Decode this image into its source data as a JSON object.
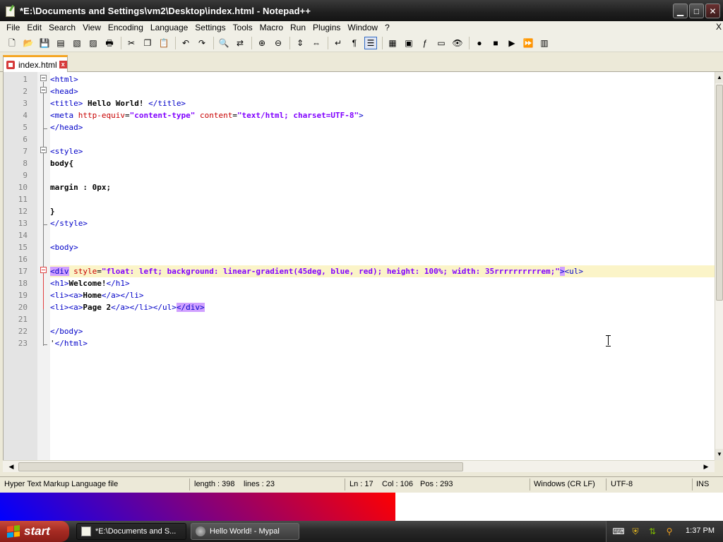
{
  "window": {
    "title": "*E:\\Documents and Settings\\vm2\\Desktop\\index.html - Notepad++",
    "minimize": "▁",
    "maximize": "□",
    "close": "✕"
  },
  "menu": [
    "File",
    "Edit",
    "Search",
    "View",
    "Encoding",
    "Language",
    "Settings",
    "Tools",
    "Macro",
    "Run",
    "Plugins",
    "Window",
    "?"
  ],
  "menu_close": "X",
  "toolbar": {
    "icons": [
      "new-file-icon",
      "open-file-icon",
      "save-icon",
      "save-all-icon",
      "close-icon",
      "close-all-icon",
      "print-icon",
      "|",
      "cut-icon",
      "copy-icon",
      "paste-icon",
      "|",
      "undo-icon",
      "redo-icon",
      "|",
      "find-icon",
      "replace-icon",
      "|",
      "zoom-in-icon",
      "zoom-out-icon",
      "|",
      "sync-vertical-icon",
      "sync-horizontal-icon",
      "|",
      "word-wrap-icon",
      "show-all-chars-icon",
      "indent-guide-icon",
      "|",
      "udl-icon",
      "doc-map-icon",
      "function-list-icon",
      "folder-workspace-icon",
      "monitoring-icon",
      "|",
      "record-macro-icon",
      "stop-macro-icon",
      "play-macro-icon",
      "run-macro-multiple-icon",
      "save-macro-icon"
    ],
    "glyphs": {
      "new-file-icon": "🗋",
      "open-file-icon": "📂",
      "save-icon": "💾",
      "save-all-icon": "▤",
      "close-icon": "▧",
      "close-all-icon": "▨",
      "print-icon": "🖶",
      "cut-icon": "✂",
      "copy-icon": "❐",
      "paste-icon": "📋",
      "undo-icon": "↶",
      "redo-icon": "↷",
      "find-icon": "🔍",
      "replace-icon": "⇄",
      "zoom-in-icon": "⊕",
      "zoom-out-icon": "⊖",
      "sync-vertical-icon": "⇕",
      "sync-horizontal-icon": "⇔",
      "word-wrap-icon": "↵",
      "show-all-chars-icon": "¶",
      "indent-guide-icon": "☰",
      "udl-icon": "▦",
      "doc-map-icon": "▣",
      "function-list-icon": "ƒ",
      "folder-workspace-icon": "▭",
      "monitoring-icon": "👁",
      "record-macro-icon": "●",
      "stop-macro-icon": "■",
      "play-macro-icon": "▶",
      "run-macro-multiple-icon": "⏩",
      "save-macro-icon": "▥"
    },
    "active": "indent-guide-icon"
  },
  "tab": {
    "label": "index.html",
    "close": "x"
  },
  "editor": {
    "current_line": 17,
    "lines": [
      {
        "n": "1",
        "html": "<span class=\"t\">&lt;html&gt;</span>"
      },
      {
        "n": "2",
        "html": "<span class=\"t\">&lt;head&gt;</span>"
      },
      {
        "n": "3",
        "html": "<span class=\"t\">&lt;title&gt;</span><span class=\"b\"> Hello World! </span><span class=\"t\">&lt;/title&gt;</span>"
      },
      {
        "n": "4",
        "html": "<span class=\"t\">&lt;meta</span> <span class=\"a\">http-equiv</span>=<span class=\"s\">\"content-type\"</span> <span class=\"a\">content</span>=<span class=\"s\">\"text/html; charset=UTF-8\"</span><span class=\"t\">&gt;</span>"
      },
      {
        "n": "5",
        "html": "<span class=\"t\">&lt;/head&gt;</span>"
      },
      {
        "n": "6",
        "html": ""
      },
      {
        "n": "7",
        "html": "<span class=\"t\">&lt;style&gt;</span>"
      },
      {
        "n": "8",
        "html": "<span class=\"b\">body{</span>"
      },
      {
        "n": "9",
        "html": ""
      },
      {
        "n": "10",
        "html": "<span class=\"b\">margin : 0px;</span>"
      },
      {
        "n": "11",
        "html": ""
      },
      {
        "n": "12",
        "html": "<span class=\"b\">}</span>"
      },
      {
        "n": "13",
        "html": "<span class=\"t\">&lt;/style&gt;</span>"
      },
      {
        "n": "14",
        "html": ""
      },
      {
        "n": "15",
        "html": "<span class=\"t\">&lt;body&gt;</span>"
      },
      {
        "n": "16",
        "html": ""
      },
      {
        "n": "17",
        "html": "<span class=\"t m\">&lt;div</span> <span class=\"a\">style</span>=<span class=\"s\">\"float: left; background: linear-gradient(45deg, blue, red); height: 100%; width: 35rrrrrrrrrrem;\"</span><span class=\"t m\">&gt;</span><span class=\"t\">&lt;ul&gt;</span>"
      },
      {
        "n": "18",
        "html": "<span class=\"t\">&lt;h1&gt;</span><span class=\"b\">Welcome!</span><span class=\"t\">&lt;/h1&gt;</span>"
      },
      {
        "n": "19",
        "html": "<span class=\"t\">&lt;li&gt;&lt;a&gt;</span><span class=\"b\">Home</span><span class=\"t\">&lt;/a&gt;&lt;/li&gt;</span>"
      },
      {
        "n": "20",
        "html": "<span class=\"t\">&lt;li&gt;&lt;a&gt;</span><span class=\"b\">Page 2</span><span class=\"t\">&lt;/a&gt;&lt;/li&gt;&lt;/ul&gt;</span><span class=\"t m\">&lt;/div&gt;</span>"
      },
      {
        "n": "21",
        "html": ""
      },
      {
        "n": "22",
        "html": "<span class=\"t\">&lt;/body&gt;</span>"
      },
      {
        "n": "23",
        "html": "'<span class=\"t\">&lt;/html&gt;</span>"
      }
    ]
  },
  "status": {
    "filetype": "Hyper Text Markup Language file",
    "length": "length : 398",
    "lines": "lines : 23",
    "ln": "Ln : 17",
    "col": "Col : 106",
    "pos": "Pos : 293",
    "eol": "Windows (CR LF)",
    "encoding": "UTF-8",
    "mode": "INS"
  },
  "taskbar": {
    "start": "start",
    "tasks": [
      {
        "label": "*E:\\Documents and S...",
        "active": true
      },
      {
        "label": "Hello World! - Mypal",
        "active": false
      }
    ],
    "clock": "1:37 PM"
  },
  "colors": {
    "tag": "#0000c8",
    "attribute": "#c80000",
    "value": "#8000ff",
    "current_line": "#fbf4c8",
    "tag_match": "#d0a0ff"
  }
}
